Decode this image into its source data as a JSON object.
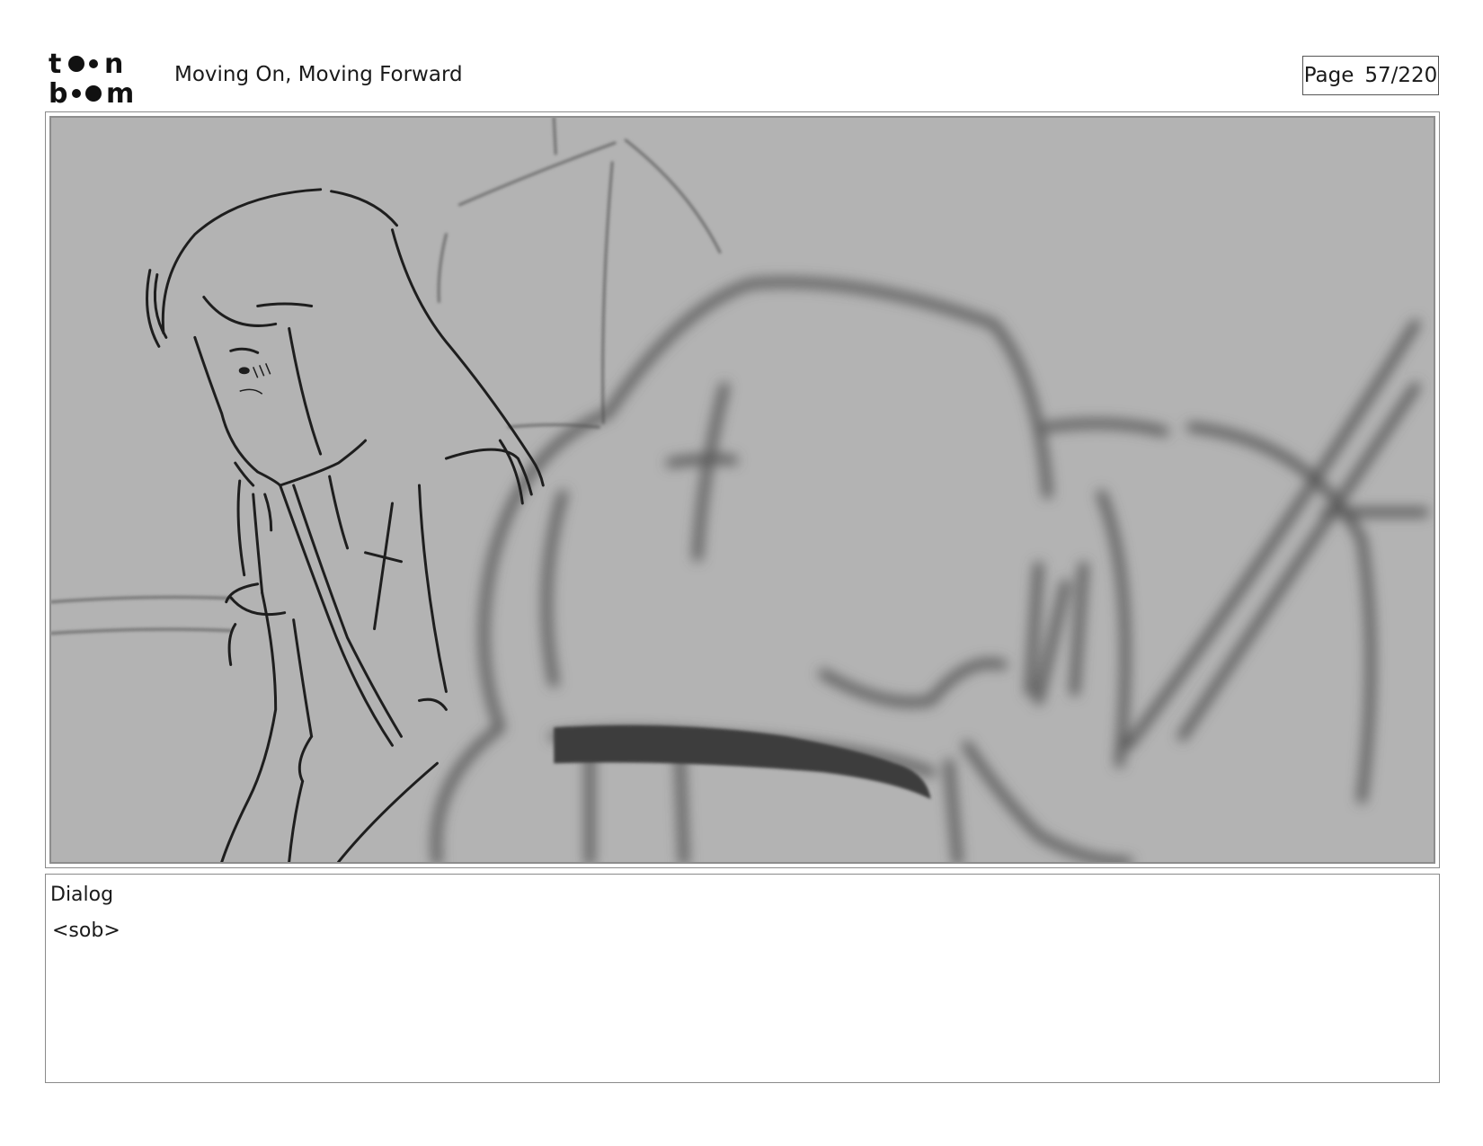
{
  "header": {
    "logo_text": "toonboom",
    "project_title": "Moving On, Moving Forward",
    "page_label": "Page",
    "page_number": "57/220"
  },
  "panel": {
    "image_background": "#b3b3b3"
  },
  "dialog": {
    "label": "Dialog",
    "text": "<sob>"
  }
}
